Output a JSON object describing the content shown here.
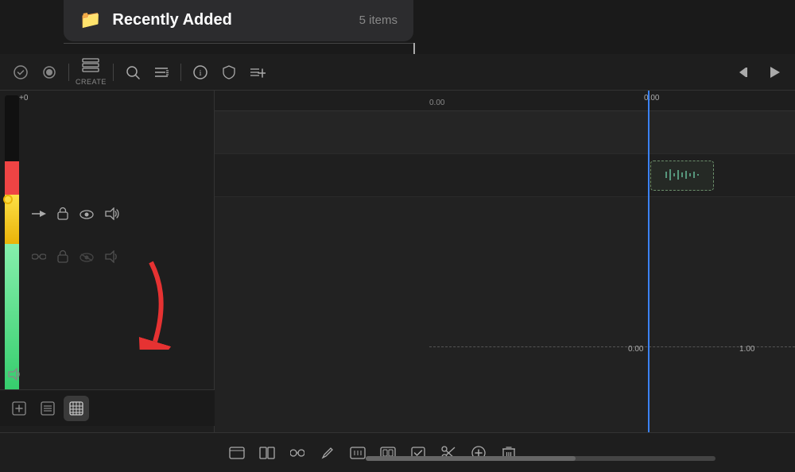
{
  "dropdown": {
    "folder_icon": "📁",
    "title": "Recently Added",
    "count": "5 items"
  },
  "toolbar": {
    "check_icon": "✓",
    "record_icon": "⏺",
    "create_icon": "⊞",
    "create_label": "CREATE",
    "search_icon": "🔍",
    "list_icon": "≡",
    "info_icon": "ⓘ",
    "shield_icon": "🛡",
    "add_track_icon": "⊕",
    "rewind_icon": "⏮",
    "play_icon": "▶"
  },
  "vu": {
    "label": "+0"
  },
  "track_controls": {
    "row1": {
      "arrow_icon": "→",
      "lock_icon": "🔓",
      "eye_icon": "👁",
      "volume_icon": "🔊"
    },
    "row2": {
      "link_icon": "🔗",
      "lock_icon": "🔒",
      "eye_icon": "👁",
      "volume_icon": "🔊"
    }
  },
  "timeline": {
    "timecode_0": "0.00",
    "timecode_1": "0.00",
    "timecode_100": "1.00"
  },
  "bottom_toolbar": {
    "icon1": "⊞",
    "icon2": "▦",
    "icon3": "∞",
    "icon4": "✏",
    "icon5": "⊡",
    "icon6": "▣",
    "icon7": "☑",
    "icon8": "✂",
    "icon9": "⊕",
    "icon10": "🗑"
  },
  "sidebar_bottom": {
    "icon1": "⊕",
    "icon2": "▤",
    "icon3": "▦"
  },
  "volume_left": {
    "icon": "🔊"
  }
}
